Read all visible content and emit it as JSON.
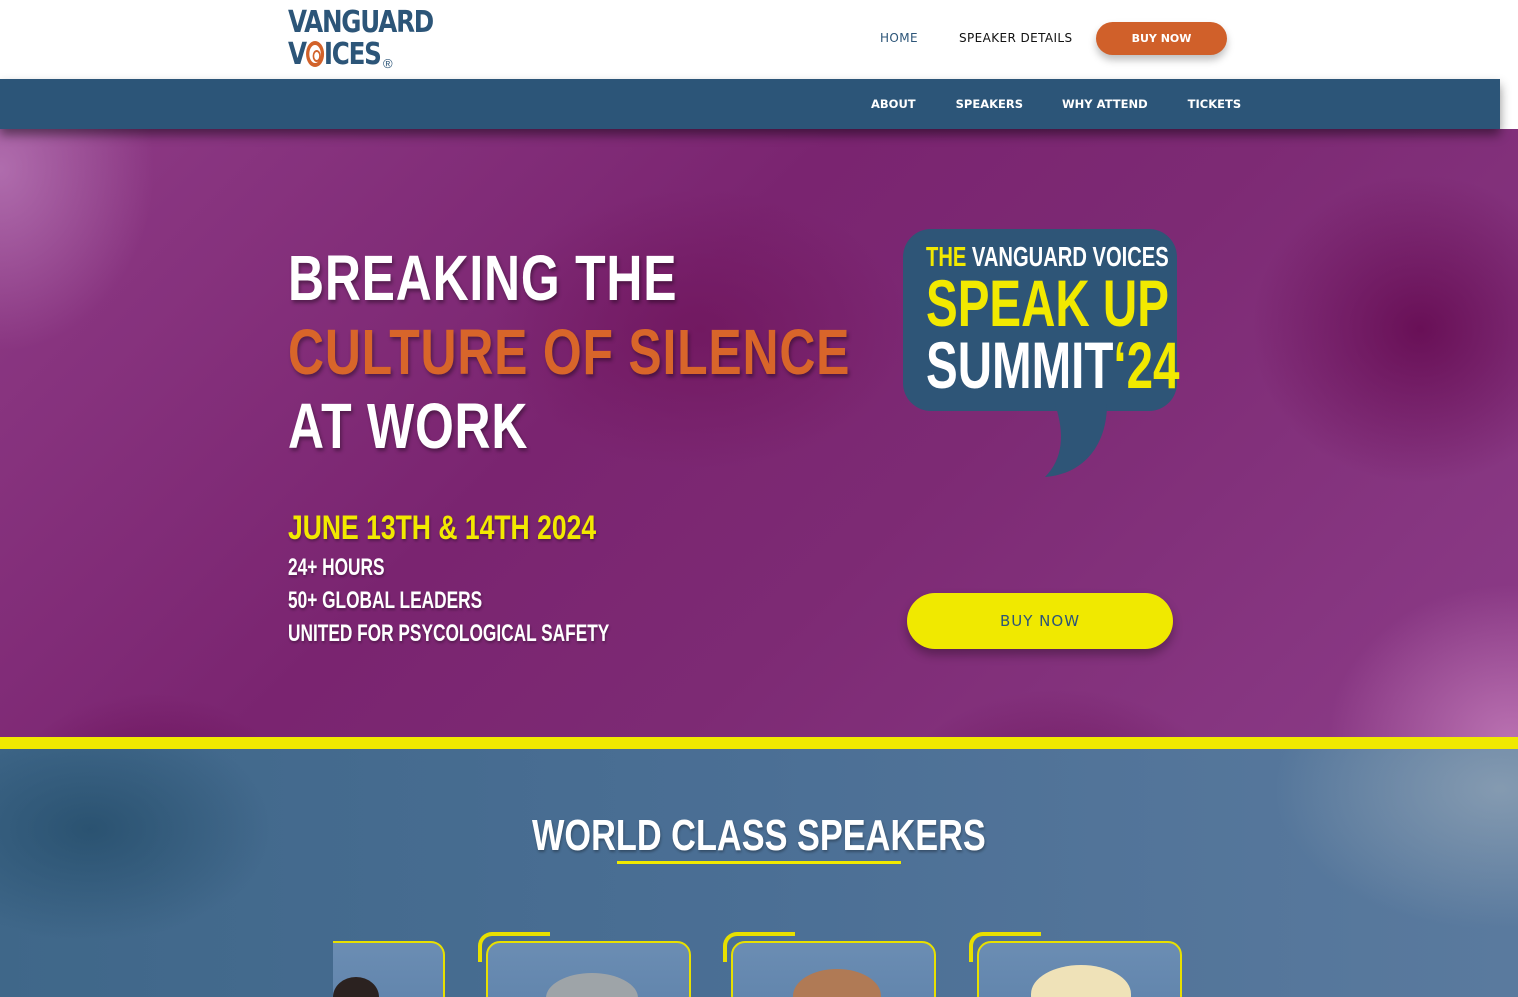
{
  "header": {
    "logo": {
      "line1": "VANGUARD",
      "line2_pre": "V",
      "line2_post": "ICES",
      "reg": "®"
    },
    "nav": [
      {
        "label": "HOME"
      },
      {
        "label": "SPEAKER DETAILS"
      }
    ],
    "buy_label": "BUY NOW"
  },
  "subnav": {
    "items": [
      {
        "label": "ABOUT"
      },
      {
        "label": "SPEAKERS"
      },
      {
        "label": "WHY ATTEND"
      },
      {
        "label": "TICKETS"
      }
    ]
  },
  "hero": {
    "title_line1": "BREAKING THE",
    "title_line2": "CULTURE OF SILENCE",
    "title_line3": "AT WORK",
    "date": "JUNE 13TH & 14TH 2024",
    "facts": [
      "24+ HOURS",
      "50+ GLOBAL LEADERS",
      "UNITED FOR PSYCOLOGICAL SAFETY"
    ],
    "badge": {
      "the": "THE",
      "brand": "VANGUARD VOICES",
      "speak_up": "SPEAK UP",
      "summit": "SUMMIT",
      "year": "‘24"
    },
    "buy_label": "BUY NOW"
  },
  "speakers": {
    "title": "WORLD CLASS SPEAKERS"
  },
  "colors": {
    "brand_blue": "#2c5578",
    "accent_orange": "#d0602a",
    "accent_yellow": "#f0e900",
    "hero_purple": "#7a2470"
  }
}
